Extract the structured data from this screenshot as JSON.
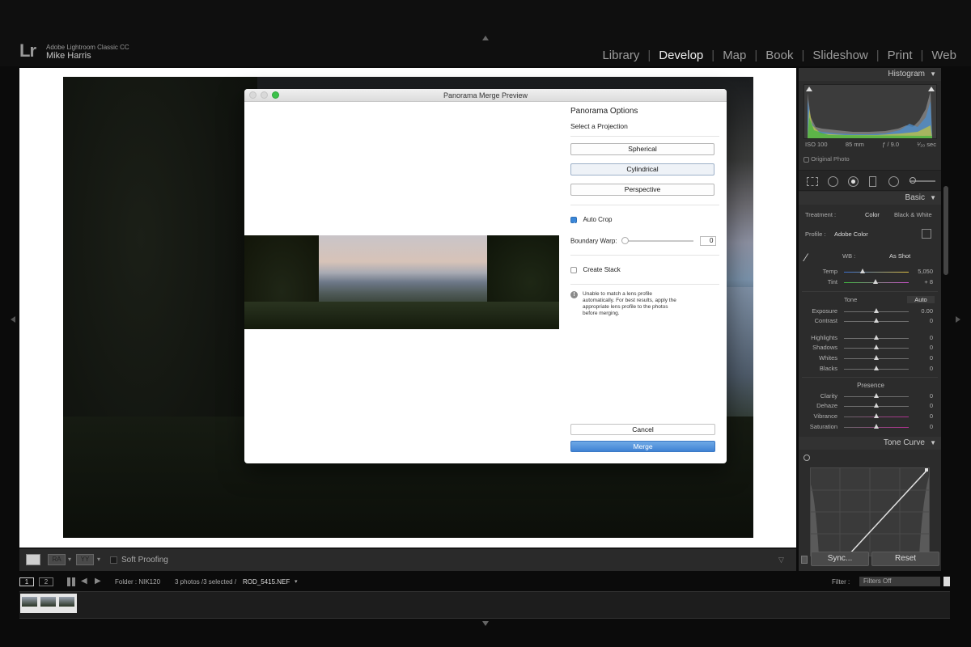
{
  "app": {
    "logo": "Lr",
    "product": "Adobe Lightroom Classic CC",
    "user": "Mike Harris",
    "modules": [
      {
        "label": "Library",
        "active": false
      },
      {
        "label": "Develop",
        "active": true
      },
      {
        "label": "Map",
        "active": false
      },
      {
        "label": "Book",
        "active": false
      },
      {
        "label": "Slideshow",
        "active": false
      },
      {
        "label": "Print",
        "active": false
      },
      {
        "label": "Web",
        "active": false
      }
    ]
  },
  "dialog": {
    "title": "Panorama Merge Preview",
    "options_title": "Panorama Options",
    "projection_title": "Select a Projection",
    "projections": [
      "Spherical",
      "Cylindrical",
      "Perspective"
    ],
    "selected_projection": "Cylindrical",
    "auto_crop_label": "Auto Crop",
    "auto_crop_checked": true,
    "boundary_warp_label": "Boundary Warp:",
    "boundary_warp_value": "0",
    "create_stack_label": "Create Stack",
    "create_stack_checked": false,
    "warning": "Unable to match a lens profile automatically. For best results, apply the appropriate lens profile to the photos before merging.",
    "cancel_label": "Cancel",
    "merge_label": "Merge"
  },
  "toolbar": {
    "soft_proofing_label": "Soft Proofing"
  },
  "panel": {
    "histogram_title": "Histogram",
    "iso": "ISO 100",
    "focal": "85 mm",
    "aperture": "ƒ / 9.0",
    "shutter": "¹⁄₂₀ sec",
    "original_photo": "Original Photo",
    "basic_title": "Basic",
    "treatment_label": "Treatment :",
    "treatment_color": "Color",
    "treatment_bw": "Black & White",
    "profile_label": "Profile :",
    "profile_value": "Adobe Color",
    "wb_label": "WB :",
    "wb_value": "As Shot",
    "temp_label": "Temp",
    "temp_value": "5,050",
    "tint_label": "Tint",
    "tint_value": "+ 8",
    "tone_label": "Tone",
    "auto_label": "Auto",
    "exposure_label": "Exposure",
    "exposure_value": "0.00",
    "contrast_label": "Contrast",
    "contrast_value": "0",
    "highlights_label": "Highlights",
    "highlights_value": "0",
    "shadows_label": "Shadows",
    "shadows_value": "0",
    "whites_label": "Whites",
    "whites_value": "0",
    "blacks_label": "Blacks",
    "blacks_value": "0",
    "presence_label": "Presence",
    "clarity_label": "Clarity",
    "clarity_value": "0",
    "dehaze_label": "Dehaze",
    "dehaze_value": "0",
    "vibrance_label": "Vibrance",
    "vibrance_value": "0",
    "saturation_label": "Saturation",
    "saturation_value": "0",
    "tone_curve_title": "Tone Curve",
    "sync_label": "Sync...",
    "reset_label": "Reset"
  },
  "filmstrip": {
    "page1": "1",
    "page2": "2",
    "folder": "Folder : NIK120",
    "selection": "3 photos /3 selected /",
    "filename": "ROD_5415.NEF",
    "filter_label": "Filter :",
    "filter_value": "Filters Off"
  },
  "colors": {
    "accent": "#3f82d4",
    "panel_bg": "#2c2c2c"
  }
}
